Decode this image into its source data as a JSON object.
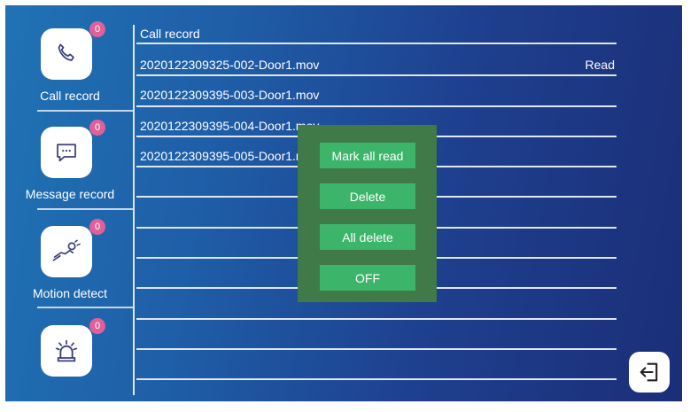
{
  "sidebar": {
    "items": [
      {
        "label": "Call record",
        "badge": "0",
        "icon": "phone-icon"
      },
      {
        "label": "Message record",
        "badge": "0",
        "icon": "message-icon"
      },
      {
        "label": "Motion detect",
        "badge": "0",
        "icon": "motion-icon"
      },
      {
        "label": "",
        "badge": "0",
        "icon": "alarm-icon"
      }
    ]
  },
  "list": {
    "title": "Call record",
    "rows": [
      {
        "name": "2020122309325-002-Door1.mov",
        "status": "Read"
      },
      {
        "name": "2020122309395-003-Door1.mov",
        "status": ""
      },
      {
        "name": "2020122309395-004-Door1.mov",
        "status": ""
      },
      {
        "name": "2020122309395-005-Door1.mov",
        "status": ""
      }
    ]
  },
  "menu": {
    "mark_all_read": "Mark all read",
    "delete": "Delete",
    "all_delete": "All delete",
    "off": "OFF"
  },
  "back_icon": "back-arrow-icon"
}
